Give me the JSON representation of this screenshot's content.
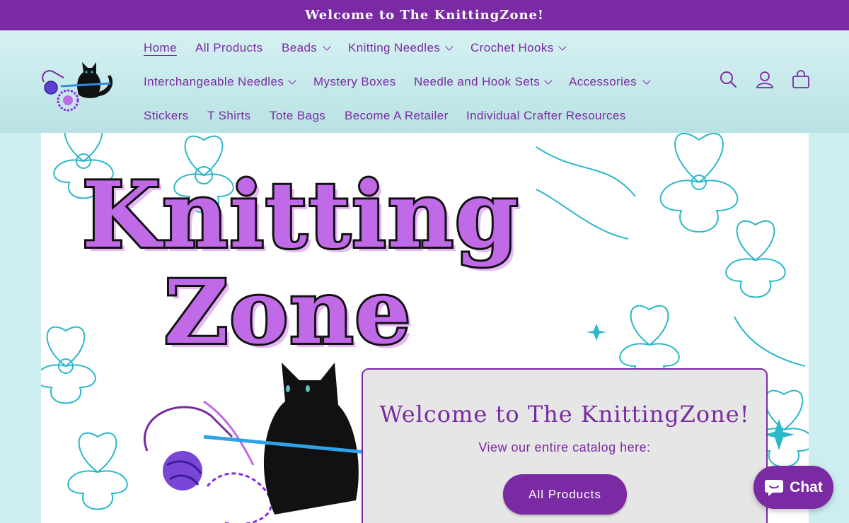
{
  "announcement": {
    "text": "Welcome to The KnittingZone!"
  },
  "nav": {
    "items": [
      {
        "label": "Home",
        "active": true
      },
      {
        "label": "All Products"
      },
      {
        "label": "Beads",
        "dropdown": true
      },
      {
        "label": "Knitting Needles",
        "dropdown": true
      },
      {
        "label": "Crochet Hooks",
        "dropdown": true
      },
      {
        "label": "Interchangeable Needles",
        "dropdown": true
      },
      {
        "label": "Mystery Boxes"
      },
      {
        "label": "Needle and Hook Sets",
        "dropdown": true
      },
      {
        "label": "Accessories",
        "dropdown": true
      },
      {
        "label": "Stickers"
      },
      {
        "label": "T Shirts"
      },
      {
        "label": "Tote Bags"
      },
      {
        "label": "Become A Retailer"
      },
      {
        "label": "Individual Crafter Resources"
      }
    ]
  },
  "header_icons": [
    "search-icon",
    "account-icon",
    "cart-icon"
  ],
  "hero": {
    "title_line1": "Knitting",
    "title_line2": "Zone",
    "welcome_title": "Welcome to The KnittingZone!",
    "welcome_subtitle": "View our entire catalog here:",
    "button_label": "All Products"
  },
  "chat": {
    "label": "Chat"
  },
  "colors": {
    "brand_purple": "#7a2aa3",
    "header_teal": "#c8ecee",
    "floral_teal": "#2bb8c8",
    "title_lilac": "#c06ae8"
  }
}
